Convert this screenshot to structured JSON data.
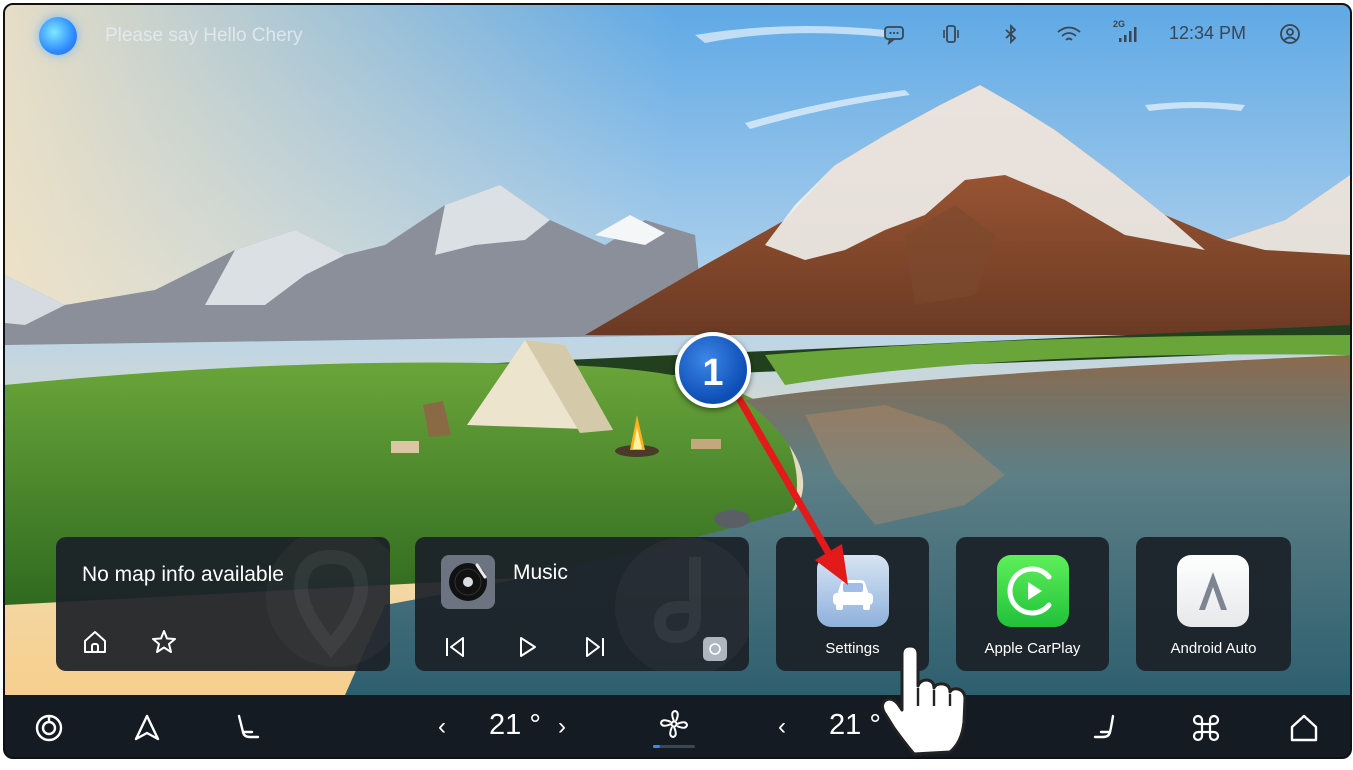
{
  "voice_prompt": "Please say Hello Chery",
  "status_bar": {
    "time": "12:34 PM",
    "signal_label": "2G",
    "icons": [
      "message-icon",
      "phone-vibrate-icon",
      "bluetooth-icon",
      "wifi-icon",
      "cellular-signal-icon",
      "user-account-icon"
    ]
  },
  "map_card": {
    "title": "No map info available",
    "icons": [
      "home-icon",
      "star-icon"
    ]
  },
  "music_card": {
    "title": "Music",
    "icons": [
      "vinyl-record-icon",
      "previous-track-icon",
      "play-icon",
      "next-track-icon"
    ]
  },
  "apps": {
    "settings": "Settings",
    "carplay": "Apple CarPlay",
    "android_auto": "Android Auto"
  },
  "bottom_bar": {
    "driver_temp": "21 °",
    "passenger_temp": "21 °",
    "temp_down": "‹",
    "temp_up": "›",
    "icons": [
      "camera-360-icon",
      "navigation-icon",
      "seat-icon",
      "fan-icon",
      "seat-heat-icon",
      "apps-grid-icon",
      "home-icon"
    ]
  },
  "annotation": {
    "step_number": "1"
  },
  "colors": {
    "card_bg": "#1c2128",
    "bottom_bar_bg": "#141b22",
    "accent_blue": "#2f8cff",
    "arrow_red": "#e21a1a",
    "carplay_green": "#2ecc40"
  }
}
